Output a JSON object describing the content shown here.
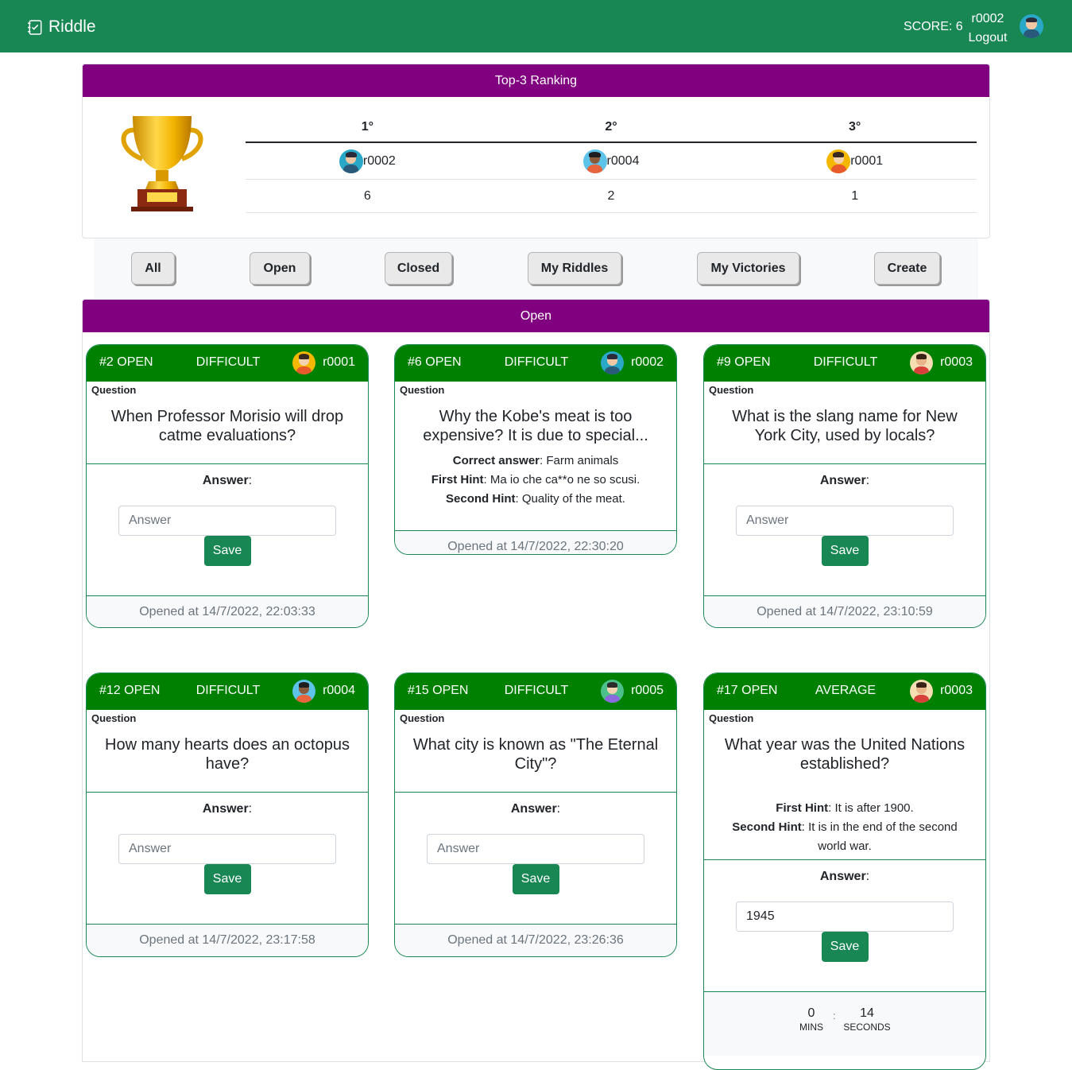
{
  "navbar": {
    "brand": "Riddle",
    "score": "SCORE: 6",
    "username": "r0002",
    "logout": "Logout"
  },
  "ranking": {
    "title": "Top-3 Ranking",
    "headers": [
      "1°",
      "2°",
      "3°"
    ],
    "users": [
      "r0002",
      "r0004",
      "r0001"
    ],
    "scores": [
      "6",
      "2",
      "1"
    ]
  },
  "filters": [
    "All",
    "Open",
    "Closed",
    "My Riddles",
    "My Victories",
    "Create"
  ],
  "open_section": {
    "title": "Open"
  },
  "labels": {
    "question": "Question",
    "answer": "Answer",
    "answer_placeholder": "Answer",
    "save": "Save",
    "correct_answer": "Correct answer",
    "first_hint": "First Hint",
    "second_hint": "Second Hint"
  },
  "riddles": [
    {
      "id": "#2 OPEN",
      "difficulty": "DIFFICULT",
      "author": "r0001",
      "question": "When Professor Morisio will drop catme evaluations?",
      "footer": "Opened at 14/7/2022, 22:03:33"
    },
    {
      "id": "#6 OPEN",
      "difficulty": "DIFFICULT",
      "author": "r0002",
      "question": "Why the Kobe's meat is too expensive? It is due to special...",
      "correct_answer": "Farm animals",
      "first_hint": "Ma io che ca**o ne so scusi.",
      "second_hint": "Quality of the meat.",
      "footer": "Opened at 14/7/2022, 22:30:20"
    },
    {
      "id": "#9 OPEN",
      "difficulty": "DIFFICULT",
      "author": "r0003",
      "question": "What is the slang name for New York City, used by locals?",
      "footer": "Opened at 14/7/2022, 23:10:59"
    },
    {
      "id": "#12 OPEN",
      "difficulty": "DIFFICULT",
      "author": "r0004",
      "question": "How many hearts does an octopus have?",
      "footer": "Opened at 14/7/2022, 23:17:58"
    },
    {
      "id": "#15 OPEN",
      "difficulty": "DIFFICULT",
      "author": "r0005",
      "question": "What city is known as \"The Eternal City\"?",
      "footer": "Opened at 14/7/2022, 23:26:36"
    },
    {
      "id": "#17 OPEN",
      "difficulty": "AVERAGE",
      "author": "r0003",
      "question": "What year was the United Nations established?",
      "first_hint": "It is after 1900.",
      "second_hint": "It is in the end of the second world war.",
      "answer_value": "1945",
      "timer": {
        "mins": "0",
        "mins_label": "MINS",
        "seconds": "14",
        "seconds_label": "SECONDS",
        "sep": ":"
      }
    }
  ]
}
